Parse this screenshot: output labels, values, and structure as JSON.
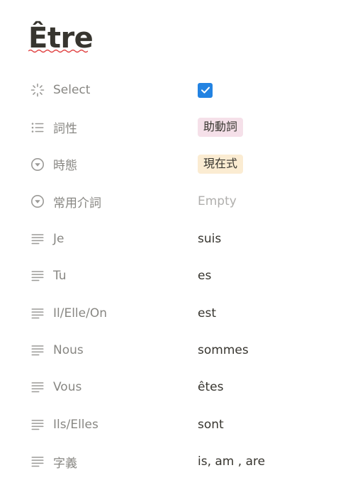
{
  "page": {
    "title": "Être"
  },
  "colors": {
    "checkbox": "#2383e2",
    "tag_pink": "#f5e0e9",
    "tag_yellow": "#fbecd2",
    "spellcheck_underline": "#e03e3e"
  },
  "properties": [
    {
      "name": "Select",
      "icon": "loader-icon",
      "type": "checkbox",
      "checked": true
    },
    {
      "name": "詞性",
      "icon": "list-icon",
      "type": "multi_select",
      "value": "助動詞",
      "color": "pink"
    },
    {
      "name": "時態",
      "icon": "select-icon",
      "type": "select",
      "value": "現在式",
      "color": "yellow"
    },
    {
      "name": "常用介詞",
      "icon": "select-icon",
      "type": "select",
      "value": "Empty",
      "empty": true
    },
    {
      "name": "Je",
      "icon": "text-icon",
      "type": "text",
      "value": "suis"
    },
    {
      "name": "Tu",
      "icon": "text-icon",
      "type": "text",
      "value": "es"
    },
    {
      "name": "Il/Elle/On",
      "icon": "text-icon",
      "type": "text",
      "value": "est"
    },
    {
      "name": "Nous",
      "icon": "text-icon",
      "type": "text",
      "value": "sommes"
    },
    {
      "name": "Vous",
      "icon": "text-icon",
      "type": "text",
      "value": "êtes"
    },
    {
      "name": "Ils/Elles",
      "icon": "text-icon",
      "type": "text",
      "value": "sont"
    },
    {
      "name": "字義",
      "icon": "text-icon",
      "type": "text",
      "value": "is, am , are"
    }
  ]
}
